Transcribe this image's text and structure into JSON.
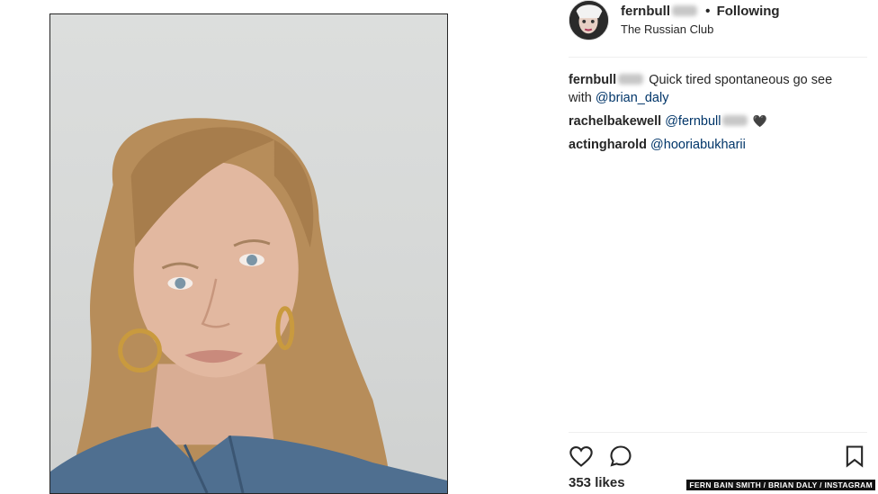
{
  "post": {
    "photo_alt_icon": "portrait-photo",
    "username": "fernbull",
    "separator": "•",
    "follow_status": "Following",
    "location": "The Russian Club"
  },
  "comments": [
    {
      "user": "fernbull",
      "text": " Quick tired spontaneous go see with ",
      "mention": "@brian_daly"
    },
    {
      "user": "rachelbakewell",
      "text": " ",
      "mention": "@fernbull",
      "emoji": "🖤"
    },
    {
      "user": "actingharold",
      "text": " ",
      "mention": "@hooriabukharii"
    }
  ],
  "actions": {
    "like_icon": "heart-icon",
    "comment_icon": "comment-icon",
    "save_icon": "bookmark-icon"
  },
  "likes": "353 likes",
  "credit": "FERN BAIN SMITH / BRIAN DALY / INSTAGRAM",
  "colors": {
    "mention": "#003569",
    "text": "#262626",
    "divider": "#efefef"
  }
}
